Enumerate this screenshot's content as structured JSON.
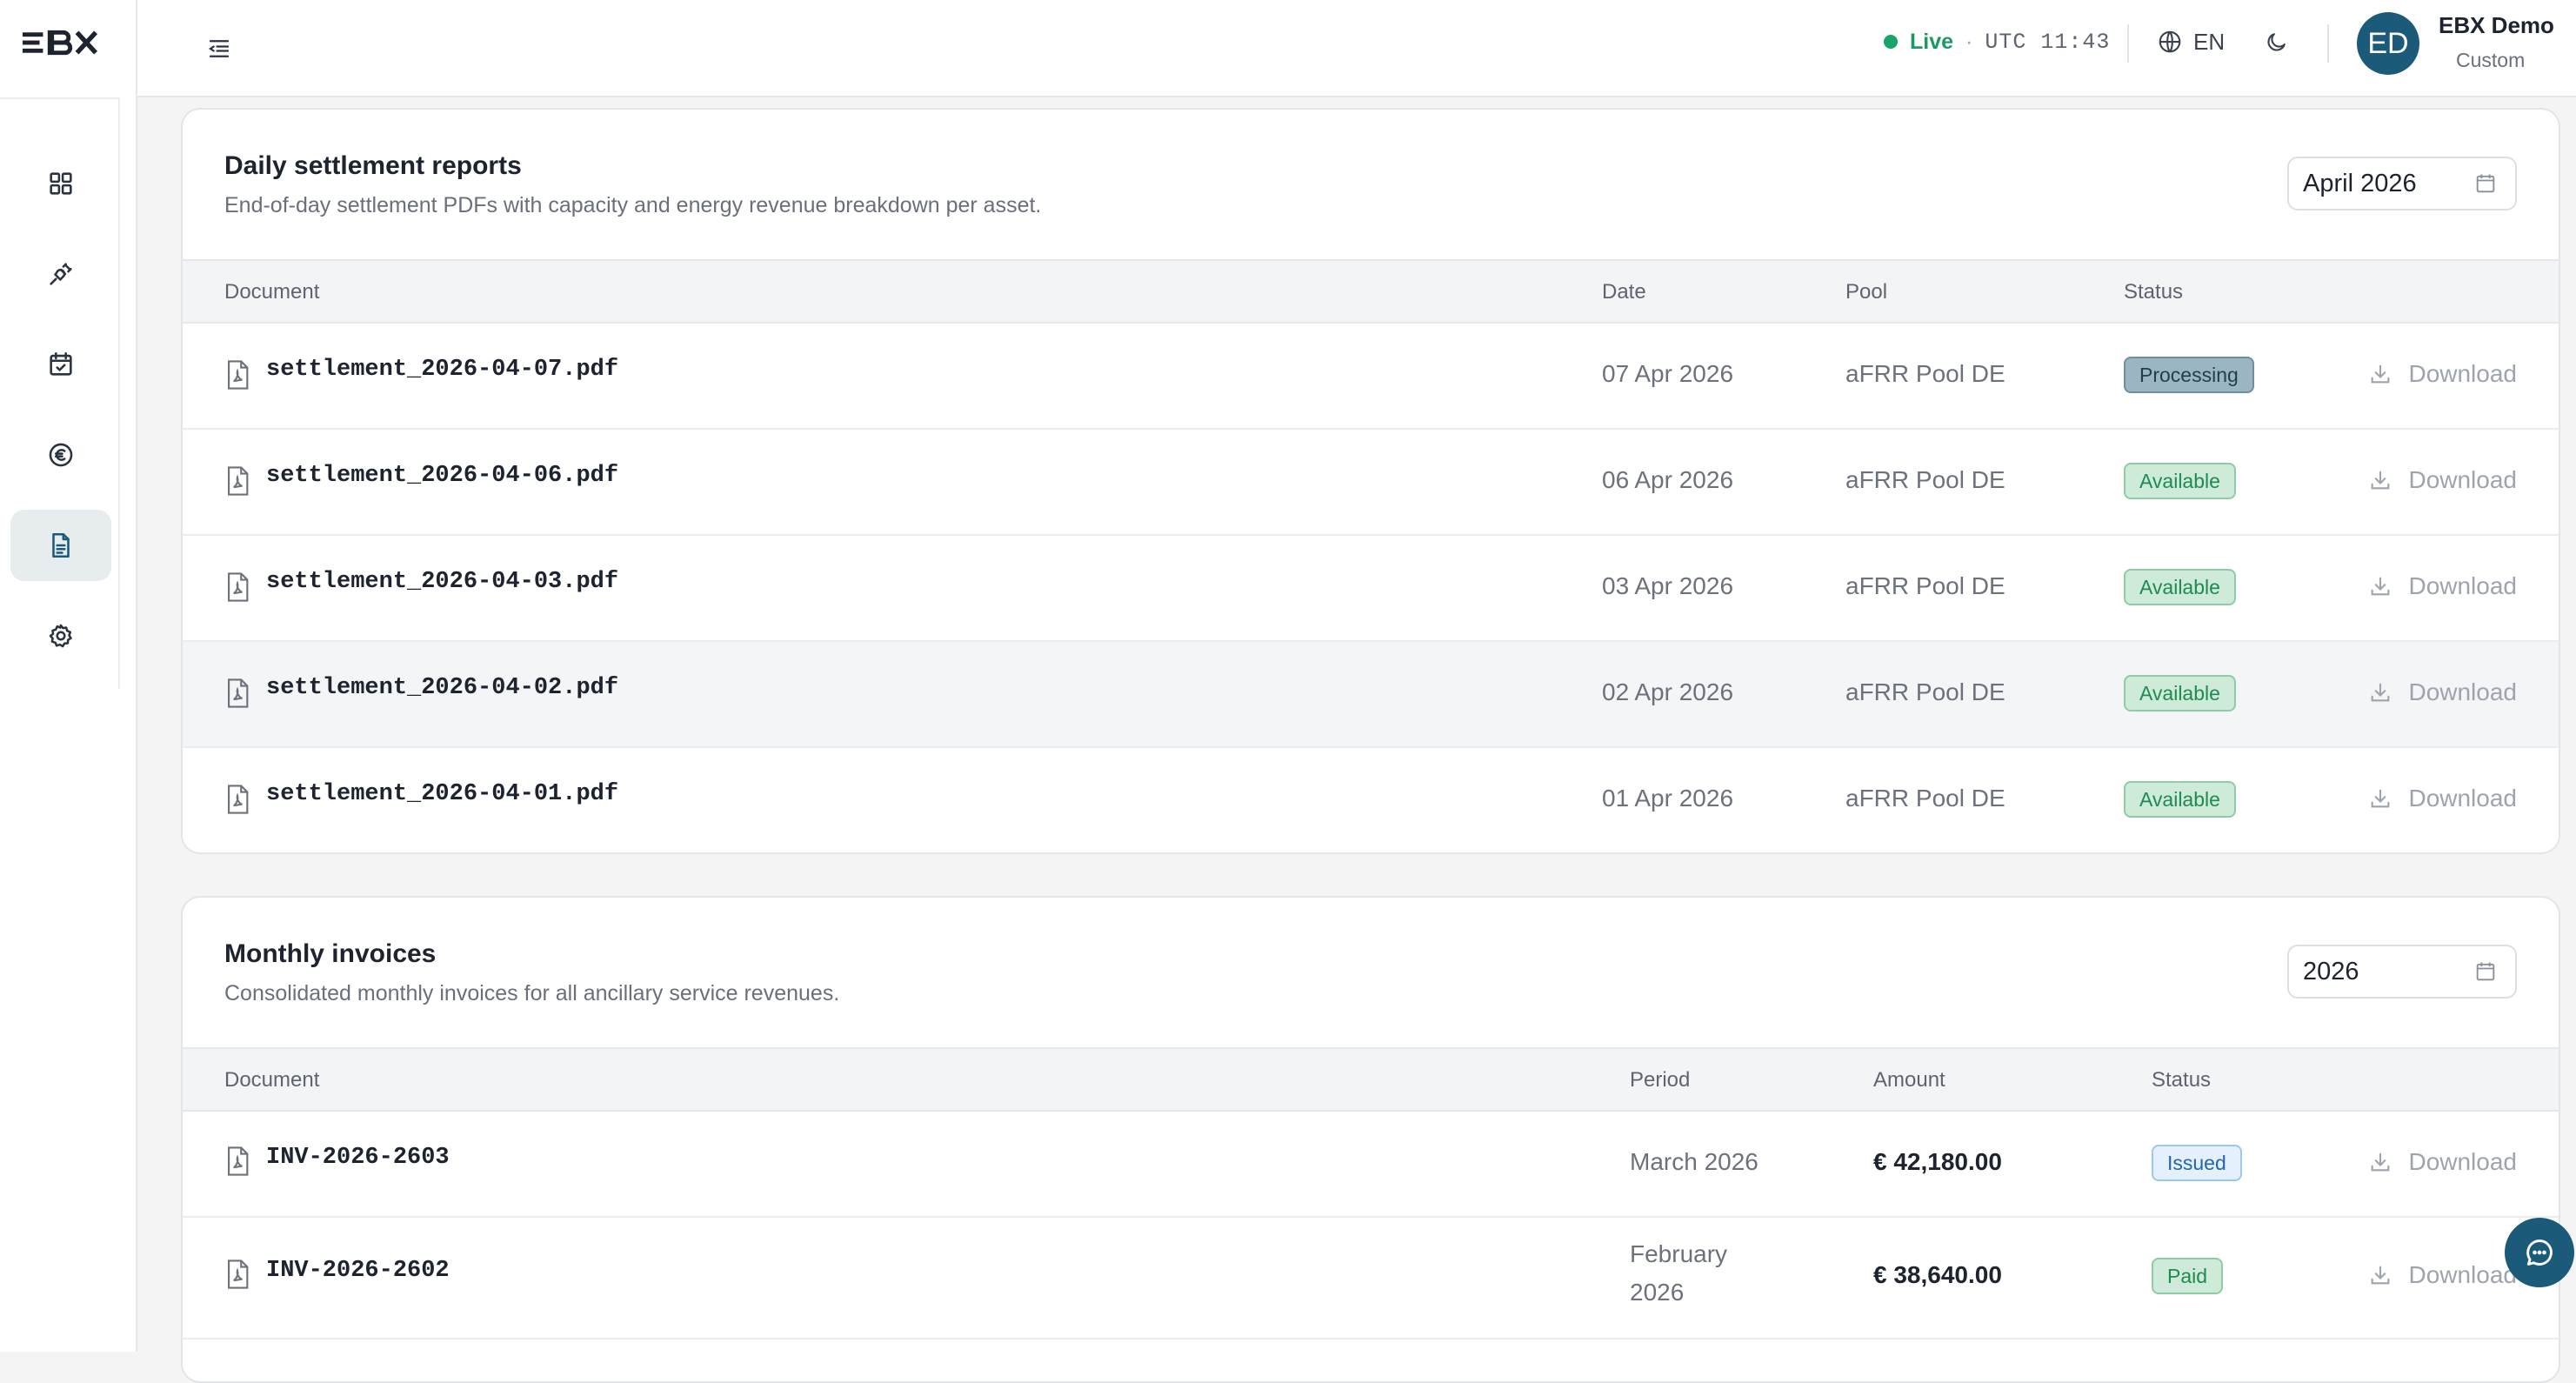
{
  "brand": {
    "logo": "EBX"
  },
  "sidebar": {
    "items": [
      {
        "name": "dashboard",
        "icon": "grid-icon"
      },
      {
        "name": "assets",
        "icon": "plug-icon"
      },
      {
        "name": "bids",
        "icon": "calendar-check-icon"
      },
      {
        "name": "revenue",
        "icon": "euro-icon"
      },
      {
        "name": "documents",
        "icon": "document-icon",
        "active": true
      },
      {
        "name": "settings",
        "icon": "gear-icon"
      }
    ]
  },
  "topbar": {
    "live_label": "Live",
    "separator": "·",
    "utc_time": "UTC 11:43",
    "language": "EN",
    "user_initials": "ED",
    "user_name": "EBX Demo",
    "user_role": "Custom"
  },
  "settlement": {
    "title": "Daily settlement reports",
    "subtitle": "End-of-day settlement PDFs with capacity and energy revenue breakdown per asset.",
    "picker_value": "April 2026",
    "columns": {
      "document": "Document",
      "date": "Date",
      "pool": "Pool",
      "status": "Status"
    },
    "rows": [
      {
        "file": "settlement_2026-04-07.pdf",
        "date": "07 Apr 2026",
        "pool": "aFRR Pool DE",
        "status": "Processing",
        "action": "Download"
      },
      {
        "file": "settlement_2026-04-06.pdf",
        "date": "06 Apr 2026",
        "pool": "aFRR Pool DE",
        "status": "Available",
        "action": "Download"
      },
      {
        "file": "settlement_2026-04-03.pdf",
        "date": "03 Apr 2026",
        "pool": "aFRR Pool DE",
        "status": "Available",
        "action": "Download"
      },
      {
        "file": "settlement_2026-04-02.pdf",
        "date": "02 Apr 2026",
        "pool": "aFRR Pool DE",
        "status": "Available",
        "action": "Download"
      },
      {
        "file": "settlement_2026-04-01.pdf",
        "date": "01 Apr 2026",
        "pool": "aFRR Pool DE",
        "status": "Available",
        "action": "Download"
      }
    ]
  },
  "invoices": {
    "title": "Monthly invoices",
    "subtitle": "Consolidated monthly invoices for all ancillary service revenues.",
    "picker_value": "2026",
    "columns": {
      "document": "Document",
      "period": "Period",
      "amount": "Amount",
      "status": "Status"
    },
    "rows": [
      {
        "file": "INV-2026-2603",
        "period_line1": "March 2026",
        "period_line2": "",
        "amount": "€ 42,180.00",
        "status": "Issued",
        "action": "Download"
      },
      {
        "file": "INV-2026-2602",
        "period_line1": "February",
        "period_line2": "2026",
        "amount": "€ 38,640.00",
        "status": "Paid",
        "action": "Download"
      }
    ]
  },
  "colors": {
    "accent": "#1c5a7a",
    "live": "#1aa36a",
    "available": "#1f8a52",
    "issued": "#2466a6"
  }
}
